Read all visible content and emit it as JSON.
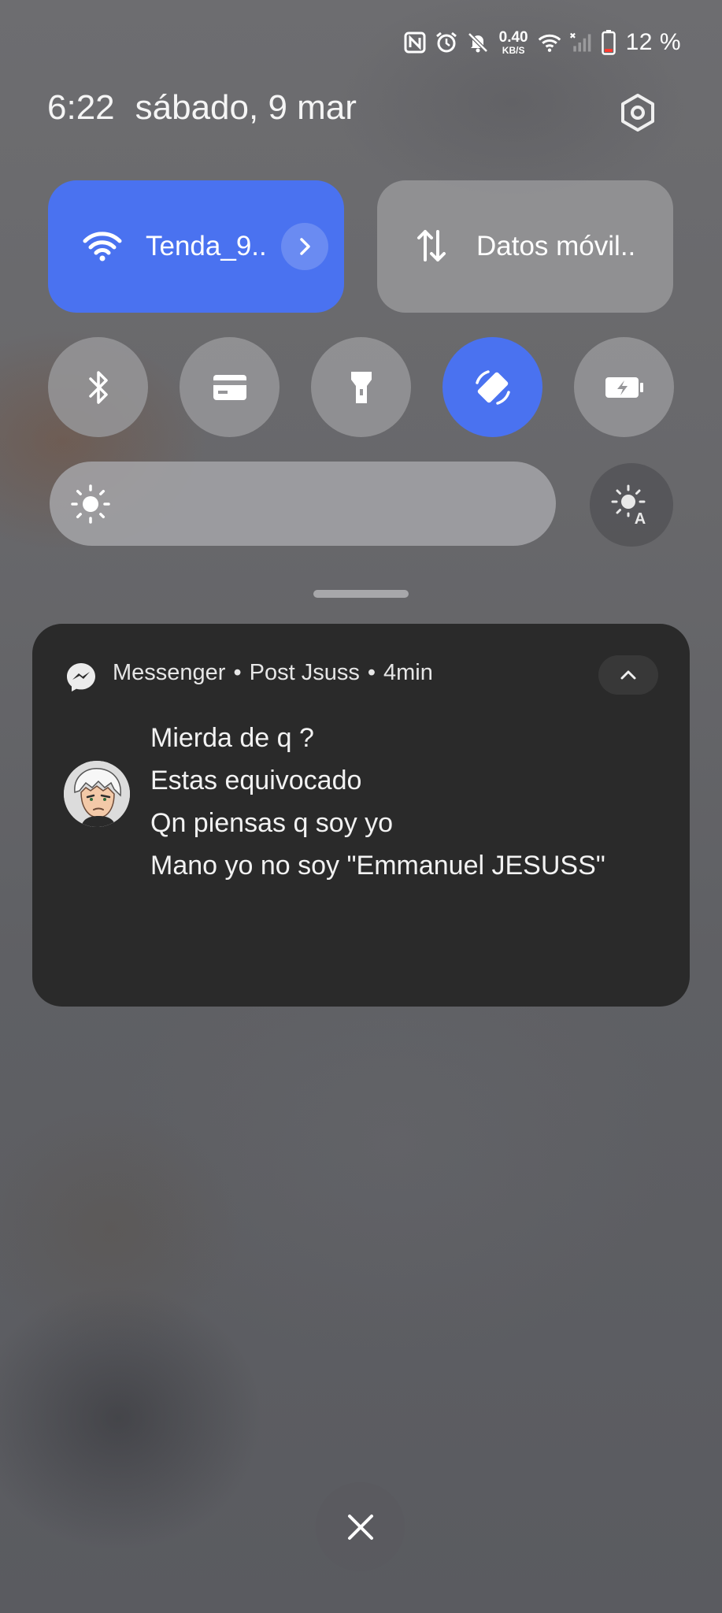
{
  "status_bar": {
    "speed_value": "0.40",
    "speed_unit": "KB/S",
    "battery_percent": "12 %"
  },
  "header": {
    "time": "6:22",
    "date": "sábado, 9 mar"
  },
  "tiles": {
    "wifi_label": "Tenda_9..",
    "data_label": "Datos móvil.."
  },
  "brightness": {
    "level": 0.02
  },
  "notification": {
    "app": "Messenger",
    "sender": "Post Jsuss",
    "time": "4min",
    "separator": "•",
    "messages": [
      "Mierda de q ?",
      "Estas equivocado",
      "Qn piensas q soy yo",
      "Mano yo no soy \"Emmanuel JESUSS\""
    ]
  },
  "colors": {
    "accent": "#4a72f0",
    "card": "#2a2a2a"
  }
}
